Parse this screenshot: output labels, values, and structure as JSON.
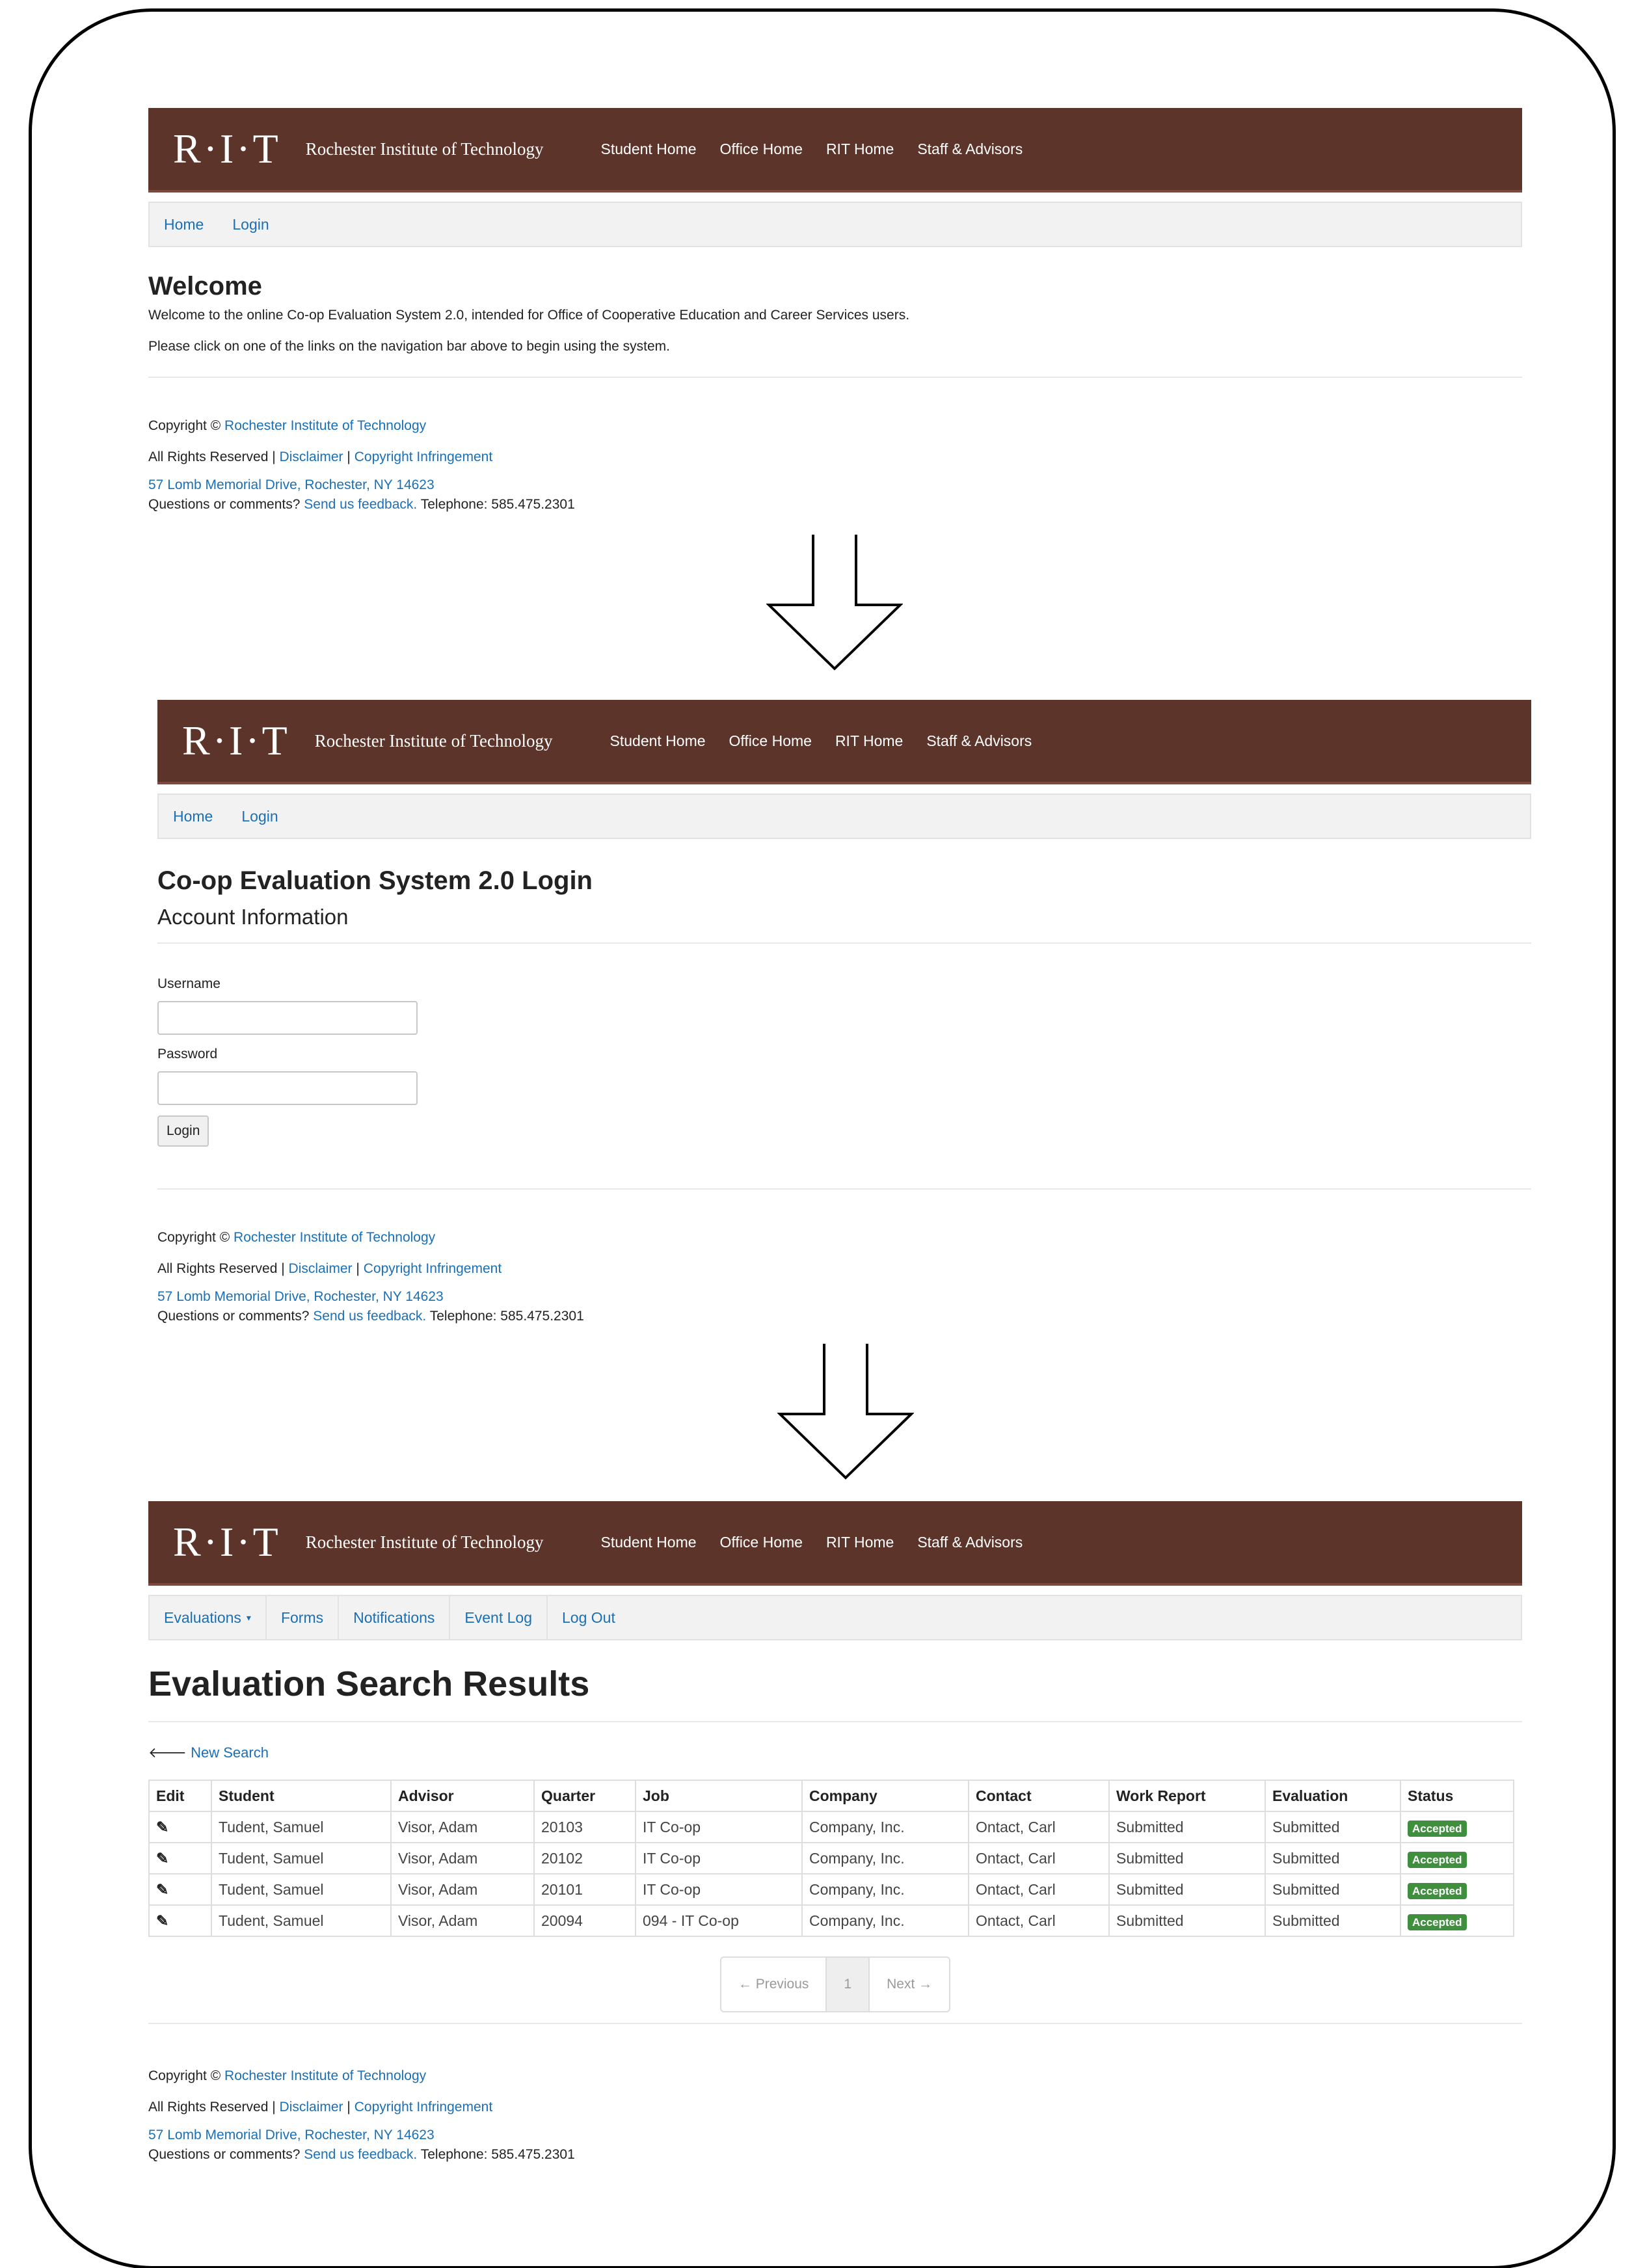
{
  "header": {
    "logo": "R·I·T",
    "institution": "Rochester Institute of Technology",
    "nav": [
      "Student Home",
      "Office Home",
      "RIT Home",
      "Staff & Advisors"
    ]
  },
  "screen1": {
    "subnav": [
      "Home",
      "Login"
    ],
    "title": "Welcome",
    "line1": "Welcome to the online Co-op Evaluation System 2.0, intended for Office of Cooperative Education and Career Services users.",
    "line2": "Please click on one of the links on the navigation bar above to begin using the system."
  },
  "screen2": {
    "subnav": [
      "Home",
      "Login"
    ],
    "title": "Co-op Evaluation System 2.0 Login",
    "subtitle": "Account Information",
    "username_label": "Username",
    "password_label": "Password",
    "username_value": "",
    "password_value": "",
    "login_button": "Login"
  },
  "screen3": {
    "subnav": [
      "Evaluations",
      "Forms",
      "Notifications",
      "Event Log",
      "Log Out"
    ],
    "title": "Evaluation Search Results",
    "new_search": "New Search",
    "columns": [
      "Edit",
      "Student",
      "Advisor",
      "Quarter",
      "Job",
      "Company",
      "Contact",
      "Work Report",
      "Evaluation",
      "Status"
    ],
    "rows": [
      {
        "student": "Tudent, Samuel",
        "advisor": "Visor, Adam",
        "quarter": "20103",
        "job": "IT Co-op",
        "company": "Company, Inc.",
        "contact": "Ontact, Carl",
        "work_report": "Submitted",
        "evaluation": "Submitted",
        "status": "Accepted"
      },
      {
        "student": "Tudent, Samuel",
        "advisor": "Visor, Adam",
        "quarter": "20102",
        "job": "IT Co-op",
        "company": "Company, Inc.",
        "contact": "Ontact, Carl",
        "work_report": "Submitted",
        "evaluation": "Submitted",
        "status": "Accepted"
      },
      {
        "student": "Tudent, Samuel",
        "advisor": "Visor, Adam",
        "quarter": "20101",
        "job": "IT Co-op",
        "company": "Company, Inc.",
        "contact": "Ontact, Carl",
        "work_report": "Submitted",
        "evaluation": "Submitted",
        "status": "Accepted"
      },
      {
        "student": "Tudent, Samuel",
        "advisor": "Visor, Adam",
        "quarter": "20094",
        "job": "094 - IT Co-op",
        "company": "Company, Inc.",
        "contact": "Ontact, Carl",
        "work_report": "Submitted",
        "evaluation": "Submitted",
        "status": "Accepted"
      }
    ],
    "pager": {
      "previous": "← Previous",
      "page": "1",
      "next": "Next →"
    }
  },
  "footer": {
    "copyright_prefix": "Copyright ©",
    "copyright_link": "Rochester Institute of Technology",
    "rights": "All Rights Reserved |",
    "disclaimer": "Disclaimer",
    "sep": "|",
    "infringement": "Copyright Infringement",
    "address": "57 Lomb Memorial Drive, Rochester, NY 14623",
    "questions": "Questions or comments?",
    "feedback": "Send us feedback.",
    "telephone": "Telephone: 585.475.2301"
  },
  "colors": {
    "header_bg": "#5c342a",
    "link": "#1a6fb5",
    "badge": "#3f8f3f"
  },
  "icons": {
    "edit": "edit-icon",
    "back": "arrow-left-icon",
    "flow": "down-arrow-icon"
  }
}
